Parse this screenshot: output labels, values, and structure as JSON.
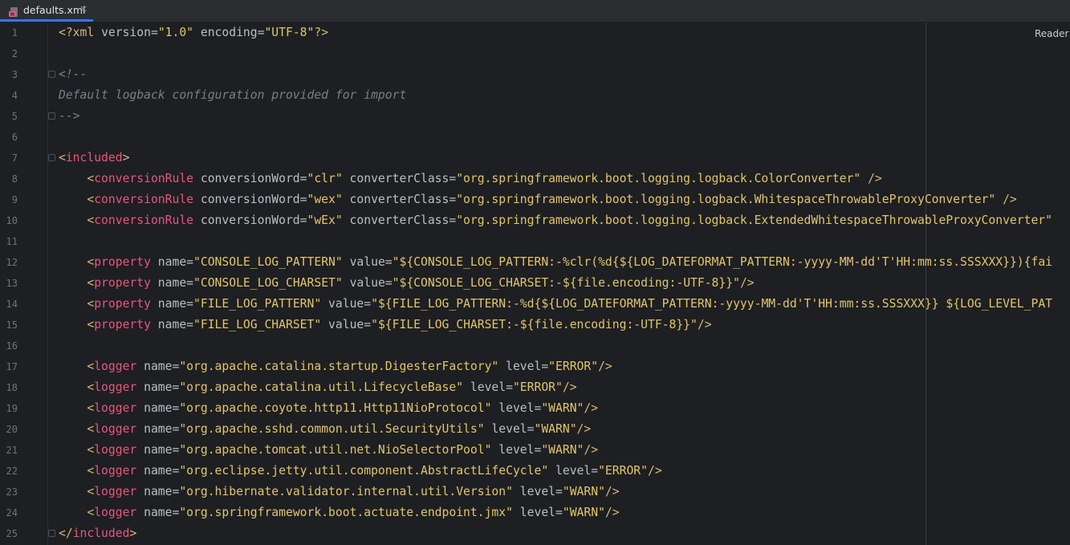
{
  "tab": {
    "file_name": "defaults.xml",
    "close_glyph": "×",
    "icon": "xml-file-icon"
  },
  "editor": {
    "reader_mode_label": "Reader Mode",
    "lines": [
      {
        "n": "1",
        "fold": false,
        "tokens": [
          {
            "k": "t",
            "s": "<?xml "
          },
          {
            "k": "a",
            "s": "version="
          },
          {
            "k": "s",
            "s": "\"1.0\""
          },
          {
            "k": "a",
            "s": " encoding="
          },
          {
            "k": "s",
            "s": "\"UTF-8\""
          },
          {
            "k": "t",
            "s": "?>"
          }
        ]
      },
      {
        "n": "2",
        "fold": false,
        "tokens": []
      },
      {
        "n": "3",
        "fold": true,
        "tokens": [
          {
            "k": "c",
            "s": "<!--"
          }
        ]
      },
      {
        "n": "4",
        "fold": false,
        "tokens": [
          {
            "k": "c",
            "s": "Default logback configuration provided for import"
          }
        ]
      },
      {
        "n": "5",
        "fold": true,
        "tokens": [
          {
            "k": "c",
            "s": "-->"
          }
        ]
      },
      {
        "n": "6",
        "fold": false,
        "tokens": []
      },
      {
        "n": "7",
        "fold": true,
        "tokens": [
          {
            "k": "t",
            "s": "<"
          },
          {
            "k": "tn",
            "s": "included"
          },
          {
            "k": "t",
            "s": ">"
          }
        ]
      },
      {
        "n": "8",
        "fold": false,
        "tokens": [
          {
            "k": "a",
            "s": "    "
          },
          {
            "k": "t",
            "s": "<"
          },
          {
            "k": "tn",
            "s": "conversionRule"
          },
          {
            "k": "a",
            "s": " conversionWord="
          },
          {
            "k": "s",
            "s": "\"clr\""
          },
          {
            "k": "a",
            "s": " converterClass="
          },
          {
            "k": "s",
            "s": "\"org.springframework.boot.logging.logback.ColorConverter\""
          },
          {
            "k": "t",
            "s": " />"
          }
        ]
      },
      {
        "n": "9",
        "fold": false,
        "tokens": [
          {
            "k": "a",
            "s": "    "
          },
          {
            "k": "t",
            "s": "<"
          },
          {
            "k": "tn",
            "s": "conversionRule"
          },
          {
            "k": "a",
            "s": " conversionWord="
          },
          {
            "k": "s",
            "s": "\"wex\""
          },
          {
            "k": "a",
            "s": " converterClass="
          },
          {
            "k": "s",
            "s": "\"org.springframework.boot.logging.logback.WhitespaceThrowableProxyConverter\""
          },
          {
            "k": "t",
            "s": " />"
          }
        ]
      },
      {
        "n": "10",
        "fold": false,
        "tokens": [
          {
            "k": "a",
            "s": "    "
          },
          {
            "k": "t",
            "s": "<"
          },
          {
            "k": "tn",
            "s": "conversionRule"
          },
          {
            "k": "a",
            "s": " conversionWord="
          },
          {
            "k": "s",
            "s": "\"wEx\""
          },
          {
            "k": "a",
            "s": " converterClass="
          },
          {
            "k": "s",
            "s": "\"org.springframework.boot.logging.logback.ExtendedWhitespaceThrowableProxyConverter\""
          }
        ]
      },
      {
        "n": "11",
        "fold": false,
        "tokens": []
      },
      {
        "n": "12",
        "fold": false,
        "tokens": [
          {
            "k": "a",
            "s": "    "
          },
          {
            "k": "t",
            "s": "<"
          },
          {
            "k": "tn",
            "s": "property"
          },
          {
            "k": "a",
            "s": " name="
          },
          {
            "k": "s",
            "s": "\"CONSOLE_LOG_PATTERN\""
          },
          {
            "k": "a",
            "s": " value="
          },
          {
            "k": "s",
            "s": "\"${CONSOLE_LOG_PATTERN:-%clr(%d{${LOG_DATEFORMAT_PATTERN:-yyyy-MM-dd'T'HH:mm:ss.SSSXXX}}){fai"
          }
        ]
      },
      {
        "n": "13",
        "fold": false,
        "tokens": [
          {
            "k": "a",
            "s": "    "
          },
          {
            "k": "t",
            "s": "<"
          },
          {
            "k": "tn",
            "s": "property"
          },
          {
            "k": "a",
            "s": " name="
          },
          {
            "k": "s",
            "s": "\"CONSOLE_LOG_CHARSET\""
          },
          {
            "k": "a",
            "s": " value="
          },
          {
            "k": "s",
            "s": "\"${CONSOLE_LOG_CHARSET:-${file.encoding:-UTF-8}}\""
          },
          {
            "k": "t",
            "s": "/>"
          }
        ]
      },
      {
        "n": "14",
        "fold": false,
        "tokens": [
          {
            "k": "a",
            "s": "    "
          },
          {
            "k": "t",
            "s": "<"
          },
          {
            "k": "tn",
            "s": "property"
          },
          {
            "k": "a",
            "s": " name="
          },
          {
            "k": "s",
            "s": "\"FILE_LOG_PATTERN\""
          },
          {
            "k": "a",
            "s": " value="
          },
          {
            "k": "s",
            "s": "\"${FILE_LOG_PATTERN:-%d{${LOG_DATEFORMAT_PATTERN:-yyyy-MM-dd'T'HH:mm:ss.SSSXXX}} ${LOG_LEVEL_PAT"
          }
        ]
      },
      {
        "n": "15",
        "fold": false,
        "tokens": [
          {
            "k": "a",
            "s": "    "
          },
          {
            "k": "t",
            "s": "<"
          },
          {
            "k": "tn",
            "s": "property"
          },
          {
            "k": "a",
            "s": " name="
          },
          {
            "k": "s",
            "s": "\"FILE_LOG_CHARSET\""
          },
          {
            "k": "a",
            "s": " value="
          },
          {
            "k": "s",
            "s": "\"${FILE_LOG_CHARSET:-${file.encoding:-UTF-8}}\""
          },
          {
            "k": "t",
            "s": "/>"
          }
        ]
      },
      {
        "n": "16",
        "fold": false,
        "tokens": []
      },
      {
        "n": "17",
        "fold": false,
        "tokens": [
          {
            "k": "a",
            "s": "    "
          },
          {
            "k": "t",
            "s": "<"
          },
          {
            "k": "tn",
            "s": "logger"
          },
          {
            "k": "a",
            "s": " name="
          },
          {
            "k": "s",
            "s": "\"org.apache.catalina.startup.DigesterFactory\""
          },
          {
            "k": "a",
            "s": " level="
          },
          {
            "k": "s",
            "s": "\"ERROR\""
          },
          {
            "k": "t",
            "s": "/>"
          }
        ]
      },
      {
        "n": "18",
        "fold": false,
        "tokens": [
          {
            "k": "a",
            "s": "    "
          },
          {
            "k": "t",
            "s": "<"
          },
          {
            "k": "tn",
            "s": "logger"
          },
          {
            "k": "a",
            "s": " name="
          },
          {
            "k": "s",
            "s": "\"org.apache.catalina.util.LifecycleBase\""
          },
          {
            "k": "a",
            "s": " level="
          },
          {
            "k": "s",
            "s": "\"ERROR\""
          },
          {
            "k": "t",
            "s": "/>"
          }
        ]
      },
      {
        "n": "19",
        "fold": false,
        "tokens": [
          {
            "k": "a",
            "s": "    "
          },
          {
            "k": "t",
            "s": "<"
          },
          {
            "k": "tn",
            "s": "logger"
          },
          {
            "k": "a",
            "s": " name="
          },
          {
            "k": "s",
            "s": "\"org.apache.coyote.http11.Http11NioProtocol\""
          },
          {
            "k": "a",
            "s": " level="
          },
          {
            "k": "s",
            "s": "\"WARN\""
          },
          {
            "k": "t",
            "s": "/>"
          }
        ]
      },
      {
        "n": "20",
        "fold": false,
        "tokens": [
          {
            "k": "a",
            "s": "    "
          },
          {
            "k": "t",
            "s": "<"
          },
          {
            "k": "tn",
            "s": "logger"
          },
          {
            "k": "a",
            "s": " name="
          },
          {
            "k": "s",
            "s": "\"org.apache.sshd.common.util.SecurityUtils\""
          },
          {
            "k": "a",
            "s": " level="
          },
          {
            "k": "s",
            "s": "\"WARN\""
          },
          {
            "k": "t",
            "s": "/>"
          }
        ]
      },
      {
        "n": "21",
        "fold": false,
        "tokens": [
          {
            "k": "a",
            "s": "    "
          },
          {
            "k": "t",
            "s": "<"
          },
          {
            "k": "tn",
            "s": "logger"
          },
          {
            "k": "a",
            "s": " name="
          },
          {
            "k": "s",
            "s": "\"org.apache.tomcat.util.net.NioSelectorPool\""
          },
          {
            "k": "a",
            "s": " level="
          },
          {
            "k": "s",
            "s": "\"WARN\""
          },
          {
            "k": "t",
            "s": "/>"
          }
        ]
      },
      {
        "n": "22",
        "fold": false,
        "tokens": [
          {
            "k": "a",
            "s": "    "
          },
          {
            "k": "t",
            "s": "<"
          },
          {
            "k": "tn",
            "s": "logger"
          },
          {
            "k": "a",
            "s": " name="
          },
          {
            "k": "s",
            "s": "\"org.eclipse.jetty.util.component.AbstractLifeCycle\""
          },
          {
            "k": "a",
            "s": " level="
          },
          {
            "k": "s",
            "s": "\"ERROR\""
          },
          {
            "k": "t",
            "s": "/>"
          }
        ]
      },
      {
        "n": "23",
        "fold": false,
        "tokens": [
          {
            "k": "a",
            "s": "    "
          },
          {
            "k": "t",
            "s": "<"
          },
          {
            "k": "tn",
            "s": "logger"
          },
          {
            "k": "a",
            "s": " name="
          },
          {
            "k": "s",
            "s": "\"org.hibernate.validator.internal.util.Version\""
          },
          {
            "k": "a",
            "s": " level="
          },
          {
            "k": "s",
            "s": "\"WARN\""
          },
          {
            "k": "t",
            "s": "/>"
          }
        ]
      },
      {
        "n": "24",
        "fold": false,
        "tokens": [
          {
            "k": "a",
            "s": "    "
          },
          {
            "k": "t",
            "s": "<"
          },
          {
            "k": "tn",
            "s": "logger"
          },
          {
            "k": "a",
            "s": " name="
          },
          {
            "k": "s",
            "s": "\"org.springframework.boot.actuate.endpoint.jmx\""
          },
          {
            "k": "a",
            "s": " level="
          },
          {
            "k": "s",
            "s": "\"WARN\""
          },
          {
            "k": "t",
            "s": "/>"
          }
        ]
      },
      {
        "n": "25",
        "fold": true,
        "tokens": [
          {
            "k": "t",
            "s": "</"
          },
          {
            "k": "tn",
            "s": "included"
          },
          {
            "k": "t",
            "s": ">"
          }
        ]
      }
    ]
  },
  "colors": {
    "background": "#1e1f22",
    "tab_accent": "#3574f0",
    "tag_bracket": "#d5b778",
    "tag_name": "#e8557c",
    "attribute": "#bcbec4",
    "string": "#e0c56b",
    "comment": "#7a7e85",
    "line_number": "#6f737a"
  }
}
